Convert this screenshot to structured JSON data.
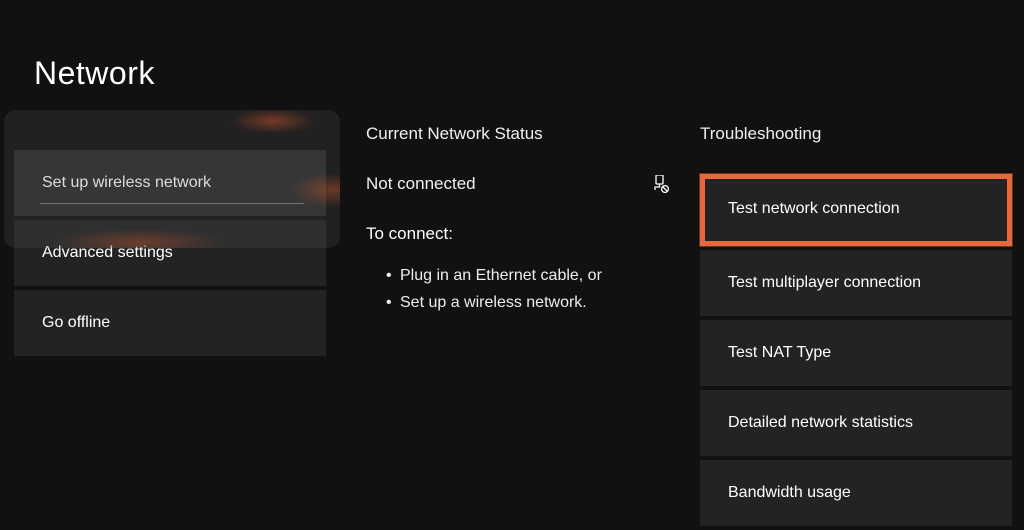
{
  "title": "Network",
  "sidebar": {
    "items": [
      {
        "label": "Set up wireless network",
        "selected": true
      },
      {
        "label": "Advanced settings",
        "selected": false
      },
      {
        "label": "Go offline",
        "selected": false
      }
    ]
  },
  "status": {
    "header": "Current Network Status",
    "value": "Not connected",
    "icon": "network-disconnected-icon",
    "connect_label": "To connect:",
    "instructions": [
      "Plug in an Ethernet cable, or",
      "Set up a wireless network."
    ]
  },
  "troubleshooting": {
    "header": "Troubleshooting",
    "items": [
      {
        "label": "Test network connection",
        "highlighted": true
      },
      {
        "label": "Test multiplayer connection",
        "highlighted": false
      },
      {
        "label": "Test NAT Type",
        "highlighted": false
      },
      {
        "label": "Detailed network statistics",
        "highlighted": false
      },
      {
        "label": "Bandwidth usage",
        "highlighted": false
      }
    ]
  },
  "highlight_color": "#e8673d"
}
